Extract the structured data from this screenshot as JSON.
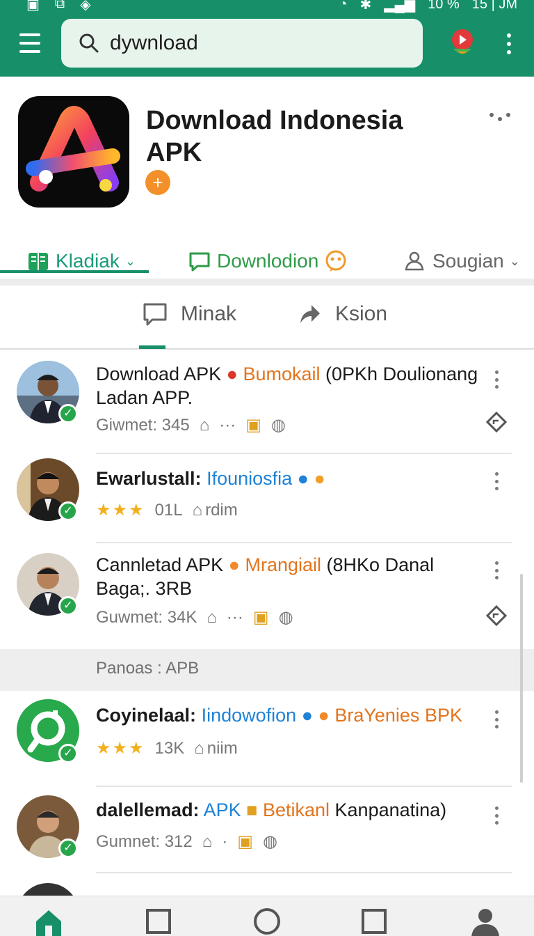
{
  "status_bar": {
    "battery": "10 %",
    "time": "15 | JM"
  },
  "search": {
    "value": "dywnload"
  },
  "app": {
    "title_line1": "Download Indonesia",
    "title_line2": "APK",
    "badge": "+"
  },
  "primary_tabs": [
    {
      "label": "Kladiak",
      "icon": "book-icon"
    },
    {
      "label": "Downlodion",
      "icon": "chat-bubble-icon"
    },
    {
      "label": "Sougian",
      "icon": "people-icon"
    }
  ],
  "secondary_tabs": [
    {
      "label": "Minak",
      "icon": "comment-icon"
    },
    {
      "label": "Ksion",
      "icon": "share-icon"
    }
  ],
  "section_header": "Panoas : APB",
  "items": [
    {
      "title_a": "Download APK",
      "title_b": "Bumokail",
      "title_c": "(0PKh Doulionang Ladan APP.",
      "meta_text": "Giwmet: 345",
      "rating": "",
      "count": ""
    },
    {
      "title_a": "Ewarlustall:",
      "title_b": "Ifouniosfia",
      "title_c": "",
      "meta_text": "",
      "rating": "★★★",
      "count": "01L",
      "extra": "rdim"
    },
    {
      "title_a": "Cannletad APK",
      "title_b": "Mrangiail",
      "title_c": "(8HKo Danal Baga;. 3RB",
      "meta_text": "Guwmet: 34K",
      "rating": "",
      "count": ""
    },
    {
      "title_a": "Coyinelaal:",
      "title_b": "Iindowofion",
      "title_c": "BraYenies BPK",
      "meta_text": "",
      "rating": "★★★",
      "count": "13K",
      "extra": "niim"
    },
    {
      "title_a": "dalellemad:",
      "title_b": "APK",
      "title_c": "Betikanl",
      "title_d": "Kanpanatina)",
      "meta_text": "Gumnet: 312",
      "rating": "",
      "count": ""
    }
  ],
  "icons": {
    "menu": "hamburger-menu-icon",
    "search": "search-icon",
    "record": "record-icon",
    "overflow": "more-vertical-icon",
    "home": "home-icon",
    "square": "square-icon",
    "circle": "circle-icon",
    "profile": "profile-icon"
  },
  "colors": {
    "brand": "#17906a",
    "accent_orange": "#e2741c",
    "link_blue": "#1f82d6",
    "star": "#f2b01e"
  }
}
